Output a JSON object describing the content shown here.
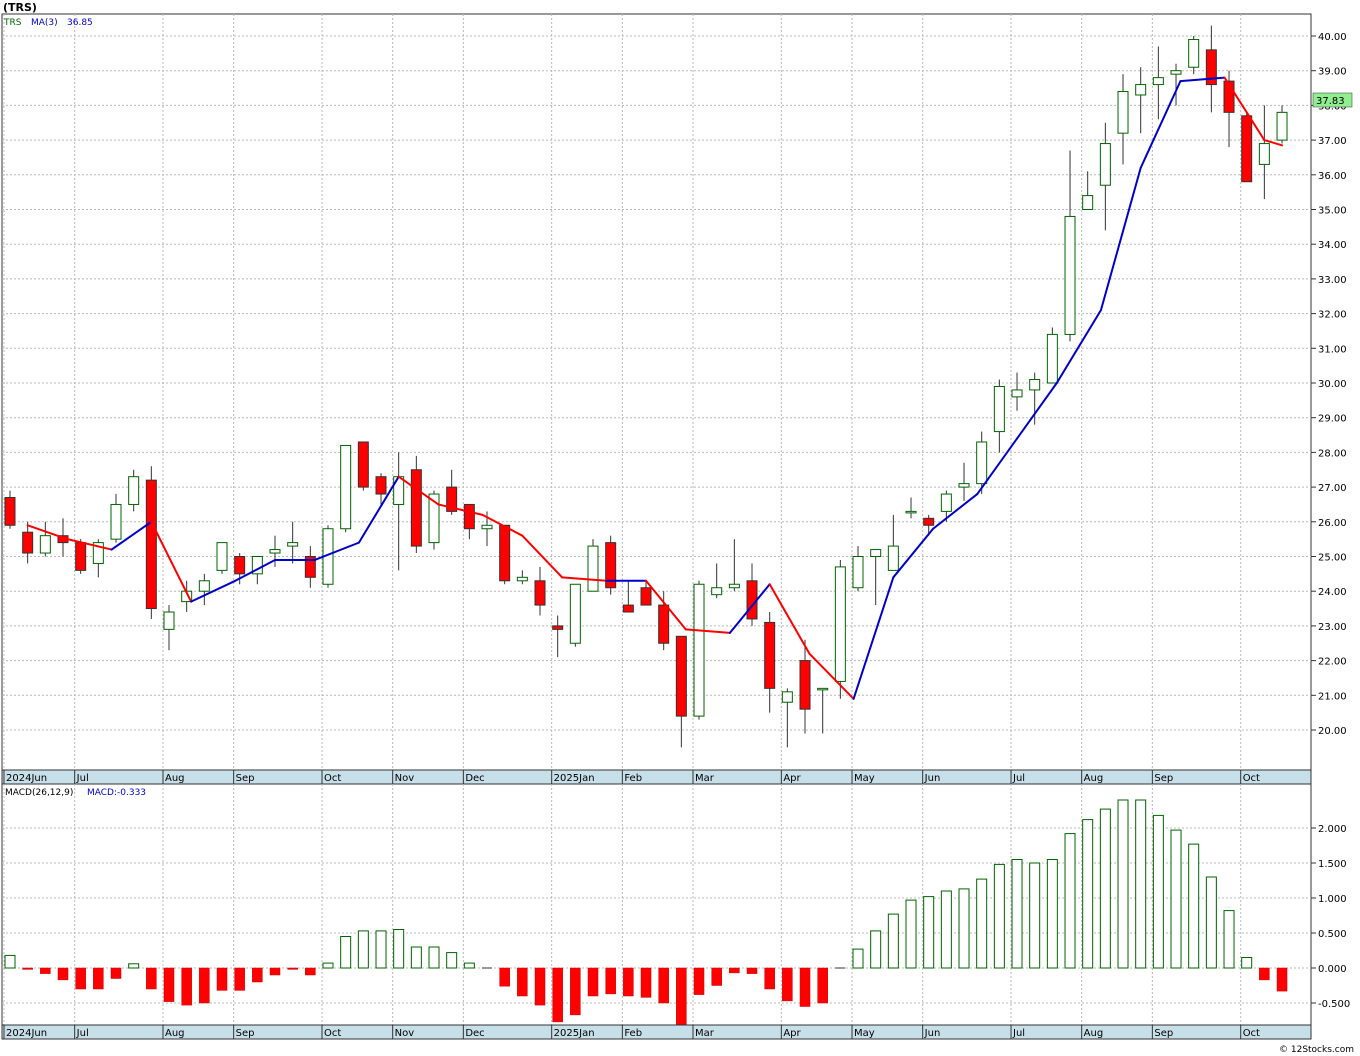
{
  "header": {
    "title": "(TRS)",
    "legend_symbol": "TRS",
    "legend_ma_label": "MA(3)",
    "legend_ma_value": "36.85",
    "macd_label": "MACD(26,12,9)",
    "macd_value_label": "MACD:-0.333",
    "last_price_badge": "37.83",
    "footer_credit": "© 12Stocks.com"
  },
  "colors": {
    "up": "#006400",
    "down": "#ff0000",
    "ma_up": "#0000cc",
    "ma_down": "#ff0000",
    "grid": "#b8b8b8",
    "axis_bar": "#c7dfe8",
    "badge": "#90ee90"
  },
  "chart_data": [
    {
      "type": "candlestick",
      "title": "",
      "price_ticks": [
        "20.00",
        "21.00",
        "22.00",
        "23.00",
        "24.00",
        "25.00",
        "26.00",
        "27.00",
        "28.00",
        "29.00",
        "30.00",
        "31.00",
        "32.00",
        "33.00",
        "34.00",
        "35.00",
        "36.00",
        "37.00",
        "38.00",
        "39.00",
        "40.00"
      ],
      "ylim": [
        19.0,
        40.6
      ],
      "month_labels": [
        "2024Jun",
        "Jul",
        "Aug",
        "Sep",
        "Oct",
        "Nov",
        "Dec",
        "2025Jan",
        "Feb",
        "Mar",
        "Apr",
        "May",
        "Jun",
        "Jul",
        "Aug",
        "Sep",
        "Oct"
      ],
      "month_week_index": [
        0,
        4,
        9,
        13,
        18,
        22,
        26,
        31,
        35,
        39,
        44,
        48,
        52,
        57,
        61,
        65,
        70
      ],
      "ohlc": [
        [
          26.7,
          26.9,
          25.8,
          25.9
        ],
        [
          25.7,
          26.0,
          24.8,
          25.1
        ],
        [
          25.1,
          26.0,
          25.0,
          25.6
        ],
        [
          25.6,
          26.1,
          25.0,
          25.4
        ],
        [
          25.4,
          25.5,
          24.5,
          24.6
        ],
        [
          24.8,
          25.5,
          24.4,
          25.4
        ],
        [
          25.5,
          26.8,
          25.4,
          26.5
        ],
        [
          26.5,
          27.5,
          26.3,
          27.3
        ],
        [
          27.2,
          27.6,
          23.2,
          23.5
        ],
        [
          22.9,
          23.6,
          22.3,
          23.4
        ],
        [
          23.7,
          24.3,
          23.4,
          24.0
        ],
        [
          24.0,
          24.5,
          23.6,
          24.3
        ],
        [
          24.6,
          25.4,
          24.5,
          25.4
        ],
        [
          25.0,
          25.1,
          24.2,
          24.5
        ],
        [
          24.5,
          25.0,
          24.2,
          25.0
        ],
        [
          25.1,
          25.6,
          24.7,
          25.2
        ],
        [
          25.3,
          26.0,
          24.8,
          25.4
        ],
        [
          25.0,
          25.3,
          24.1,
          24.4
        ],
        [
          24.2,
          25.9,
          24.1,
          25.8
        ],
        [
          25.8,
          28.2,
          25.7,
          28.2
        ],
        [
          28.3,
          28.3,
          26.9,
          27.0
        ],
        [
          27.3,
          27.4,
          26.5,
          26.8
        ],
        [
          26.5,
          28.0,
          24.6,
          27.3
        ],
        [
          27.5,
          27.9,
          25.1,
          25.3
        ],
        [
          25.4,
          26.9,
          25.2,
          26.8
        ],
        [
          27.0,
          27.5,
          26.2,
          26.3
        ],
        [
          26.5,
          26.5,
          25.5,
          25.8
        ],
        [
          25.8,
          26.3,
          25.3,
          25.9
        ],
        [
          25.9,
          25.9,
          24.2,
          24.3
        ],
        [
          24.3,
          24.6,
          24.2,
          24.4
        ],
        [
          24.3,
          24.7,
          23.3,
          23.6
        ],
        [
          23.0,
          23.3,
          22.1,
          22.9
        ],
        [
          22.5,
          24.2,
          22.4,
          24.2
        ],
        [
          24.0,
          25.5,
          24.0,
          25.3
        ],
        [
          25.4,
          25.6,
          23.9,
          24.1
        ],
        [
          23.6,
          24.3,
          23.6,
          23.4
        ],
        [
          24.1,
          24.3,
          23.6,
          23.6
        ],
        [
          23.6,
          24.0,
          22.3,
          22.5
        ],
        [
          22.7,
          22.7,
          19.5,
          20.4
        ],
        [
          20.4,
          24.3,
          20.3,
          24.2
        ],
        [
          23.9,
          24.8,
          23.8,
          24.1
        ],
        [
          24.1,
          25.5,
          24.0,
          24.2
        ],
        [
          24.3,
          24.8,
          23.0,
          23.2
        ],
        [
          23.1,
          23.4,
          20.5,
          21.2
        ],
        [
          20.8,
          21.2,
          19.5,
          21.1
        ],
        [
          22.0,
          22.6,
          19.9,
          20.6
        ],
        [
          21.2,
          21.2,
          19.9,
          21.2
        ],
        [
          21.4,
          24.9,
          20.9,
          24.7
        ],
        [
          24.1,
          25.3,
          24.0,
          25.0
        ],
        [
          25.0,
          25.2,
          23.6,
          25.2
        ],
        [
          24.6,
          26.2,
          24.6,
          25.3
        ],
        [
          26.3,
          26.7,
          26.1,
          26.3
        ],
        [
          26.1,
          26.2,
          25.6,
          25.9
        ],
        [
          26.3,
          26.9,
          26.0,
          26.8
        ],
        [
          27.0,
          27.7,
          26.6,
          27.1
        ],
        [
          27.1,
          28.6,
          26.8,
          28.3
        ],
        [
          28.6,
          30.1,
          28.0,
          29.9
        ],
        [
          29.6,
          30.3,
          29.2,
          29.8
        ],
        [
          29.8,
          30.3,
          28.8,
          30.1
        ],
        [
          30.0,
          31.6,
          30.0,
          31.4
        ],
        [
          31.4,
          36.7,
          31.2,
          34.8
        ],
        [
          35.0,
          36.1,
          35.0,
          35.4
        ],
        [
          35.7,
          37.5,
          34.4,
          36.9
        ],
        [
          37.2,
          38.9,
          36.3,
          38.4
        ],
        [
          38.3,
          39.1,
          37.2,
          38.6
        ],
        [
          38.6,
          39.7,
          37.6,
          38.8
        ],
        [
          38.9,
          39.2,
          38.0,
          39.0
        ],
        [
          39.1,
          40.0,
          38.9,
          39.9
        ],
        [
          39.6,
          40.3,
          37.8,
          38.6
        ],
        [
          38.7,
          39.0,
          36.8,
          37.8
        ],
        [
          37.7,
          37.8,
          35.8,
          35.8
        ],
        [
          36.3,
          38.0,
          35.3,
          36.9
        ],
        [
          37.0,
          38.0,
          36.9,
          37.8
        ]
      ],
      "ma_x": [
        1.0,
        3.25,
        5.75,
        8.0,
        10.25,
        12.75,
        15.0,
        17.25,
        19.75,
        22.0,
        24.25,
        26.75,
        29.0,
        31.25,
        33.75,
        36.0,
        38.25,
        40.75,
        43.0,
        45.25,
        47.75,
        50.0,
        52.25,
        54.75,
        57.0,
        59.25,
        61.75,
        64.0,
        66.25,
        68.75,
        71.0,
        72.0
      ],
      "ma_y": [
        25.9,
        25.5,
        25.2,
        26.0,
        23.7,
        24.3,
        24.9,
        24.9,
        25.4,
        27.3,
        26.5,
        26.2,
        25.6,
        24.4,
        24.3,
        24.3,
        22.9,
        22.8,
        24.2,
        22.2,
        20.9,
        24.4,
        25.8,
        26.8,
        28.4,
        30.0,
        32.1,
        36.2,
        38.7,
        38.8,
        37.0,
        36.85
      ]
    },
    {
      "type": "bar",
      "title": "",
      "value_ticks": [
        "-0.500",
        "0.000",
        "0.500",
        "1.000",
        "1.500",
        "2.000"
      ],
      "ylim": [
        -0.82,
        2.48
      ],
      "month_labels": [
        "2024Jun",
        "Jul",
        "Aug",
        "Sep",
        "Oct",
        "Nov",
        "Dec",
        "2025Jan",
        "Feb",
        "Mar",
        "Apr",
        "May",
        "Jun",
        "Jul",
        "Aug",
        "Sep",
        "Oct"
      ],
      "values": [
        0.18,
        -0.02,
        -0.08,
        -0.17,
        -0.3,
        -0.3,
        -0.15,
        0.06,
        -0.3,
        -0.48,
        -0.53,
        -0.5,
        -0.32,
        -0.32,
        -0.2,
        -0.1,
        -0.02,
        -0.1,
        0.07,
        0.45,
        0.53,
        0.53,
        0.55,
        0.3,
        0.3,
        0.22,
        0.07,
        0.0,
        -0.26,
        -0.4,
        -0.53,
        -0.77,
        -0.67,
        -0.4,
        -0.37,
        -0.4,
        -0.42,
        -0.5,
        -0.82,
        -0.38,
        -0.25,
        -0.07,
        -0.08,
        -0.3,
        -0.47,
        -0.55,
        -0.5,
        0.0,
        0.27,
        0.53,
        0.77,
        0.97,
        1.02,
        1.1,
        1.13,
        1.27,
        1.48,
        1.55,
        1.5,
        1.55,
        1.92,
        2.12,
        2.27,
        2.4,
        2.4,
        2.18,
        1.97,
        1.77,
        1.3,
        0.82,
        0.15,
        -0.17,
        -0.33
      ]
    }
  ]
}
